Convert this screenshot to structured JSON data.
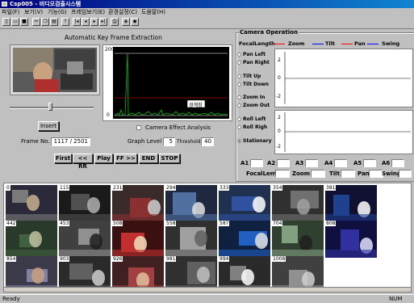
{
  "window": {
    "title": "Csp005 - 비디오검출시스템"
  },
  "menu": [
    "파일(F)",
    "보기(V)",
    "기능(G)",
    "프레임보기(E)",
    "환경설정(C)",
    "도움말(H)"
  ],
  "toolbar": [
    "new",
    "open",
    "save",
    "cut",
    "copy",
    "paste",
    "help",
    "first",
    "prev",
    "next",
    "last",
    "print",
    "about"
  ],
  "left": {
    "title": "Automatic Key Frame Extraction",
    "graph_label": "경계점",
    "insert_label": "Insert",
    "frame_no_label": "Frame No.",
    "frame_no_value": "1117 / 2501",
    "camera_effect_label": "Camera Effect Analysis",
    "graph_level_label": "Graph Level",
    "graph_level_value": "5",
    "threshold_label": "Threshold",
    "threshold_value": "40",
    "nav_buttons": [
      "First",
      "<< RR",
      "Play",
      "FF >>",
      "END",
      "STOP"
    ],
    "y_axis_top": "200",
    "y_axis_bottom": "0"
  },
  "camera": {
    "title": "Camera Operation",
    "legend": [
      {
        "name": "FocalLength",
        "color": "#000000"
      },
      {
        "name": "Zoom",
        "color": "#ff0000"
      },
      {
        "name": "Tilt",
        "color": "#008000"
      },
      {
        "name": "Pan",
        "color": "#ff0000"
      },
      {
        "name": "Swing",
        "color": "#0000ff"
      }
    ],
    "radios": [
      "Pan Left",
      "Pan Right",
      "Tilt Up",
      "Tilt Down",
      "Zoom In",
      "Zoom Out",
      "Roll Left",
      "Roll Righ",
      "Stationary"
    ],
    "selected": "Stationary",
    "ticks_top": [
      "2",
      "0",
      "-2"
    ],
    "ticks_bottom": [
      "2",
      "0",
      "-2"
    ],
    "fields_row1": [
      "A1",
      "A2",
      "A3",
      "A4",
      "A5",
      "A6"
    ],
    "fields_row2": [
      "FocalLenth",
      "Zoom",
      "Tilt",
      "Pan",
      "Swing"
    ]
  },
  "thumbnails": [
    "0",
    "115",
    "231",
    "294",
    "333",
    "354",
    "381",
    "442",
    "453",
    "508",
    "558",
    "587",
    "704",
    "808",
    "854",
    "903",
    "926",
    "981",
    "994",
    "1008"
  ],
  "status": {
    "left": "Ready",
    "right": "NUM"
  }
}
